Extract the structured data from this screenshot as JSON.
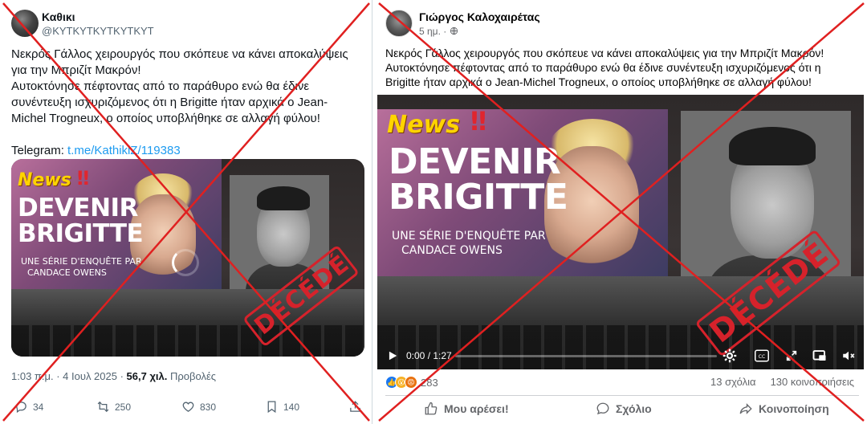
{
  "left_post": {
    "display_name": "Καθικι",
    "handle": "@ΚΥΤΚΥΤΚΥΤΚΥΤΚΥΤ",
    "paragraphs": [
      "Νεκρός Γάλλος χειρουργός που σκόπευε να κάνει αποκαλύψεις για την Μπριζίτ Μακρόν!",
      "Αυτοκτόνησε πέφτοντας από το παράθυρο ενώ θα έδινε συνέντευξη ισχυριζόμενος ότι η Brigitte ήταν αρχικά ο Jean-Michel Trogneux, ο οποίος υποβλήθηκε σε αλλαγή φύλου!"
    ],
    "telegram_label": "Telegram:",
    "telegram_link": "t.me/KathikiZ/119383",
    "video": {
      "news": "News",
      "bangs": "‼",
      "headline_1": "DEVENIR",
      "headline_2": "BRIGITTE",
      "sub_1": "UNE SÉRIE D'ENQUÊTE PAR",
      "sub_2": "CANDACE OWENS",
      "stamp": "DÉCÉDÉ"
    },
    "meta_time": "1:03 π.μ. · 4 Ιουλ 2025 · ",
    "meta_views": "56,7 χιλ.",
    "meta_views_label": " Προβολές",
    "actions": {
      "replies": "34",
      "reposts": "250",
      "likes": "830",
      "bookmarks": "140"
    },
    "icons": [
      "reply-icon",
      "repost-icon",
      "like-icon",
      "bookmark-icon",
      "share-icon"
    ]
  },
  "right_post": {
    "display_name": "Γιώργος Καλοχαιρέτας",
    "time": "5 ημ. ·",
    "text": "Νεκρός Γάλλος χειρουργός που σκόπευε να κάνει αποκαλύψεις για την Μπριζίτ Μακρόν! Αυτοκτόνησε πέφτοντας από το παράθυρο ενώ θα έδινε συνέντευξη ισχυριζόμενος ότι η Brigitte ήταν αρχικά ο Jean-Michel Trogneux, ο οποίος υποβλήθηκε σε αλλαγή φύλου!",
    "video": {
      "news": "News",
      "bangs": "‼",
      "headline_1": "DEVENIR",
      "headline_2": "BRIGITTE",
      "sub_1": "UNE SÉRIE D'ENQUÊTE PAR",
      "sub_2": "CANDACE OWENS",
      "stamp": "DÉCÉDÉ",
      "time_display": "0:00 / 1:27",
      "progress": 0.0
    },
    "reaction_count": "283",
    "comments": "13 σχόλια",
    "shares": "130 κοινοποιήσεις",
    "actions": {
      "like": "Μου αρέσει!",
      "comment": "Σχόλιο",
      "share": "Κοινοποίηση"
    }
  },
  "colors": {
    "debunk_red": "#e02020",
    "twitter_link": "#1d9bf0",
    "stamp_red": "#d6222b",
    "news_yellow": "#ffd400"
  }
}
